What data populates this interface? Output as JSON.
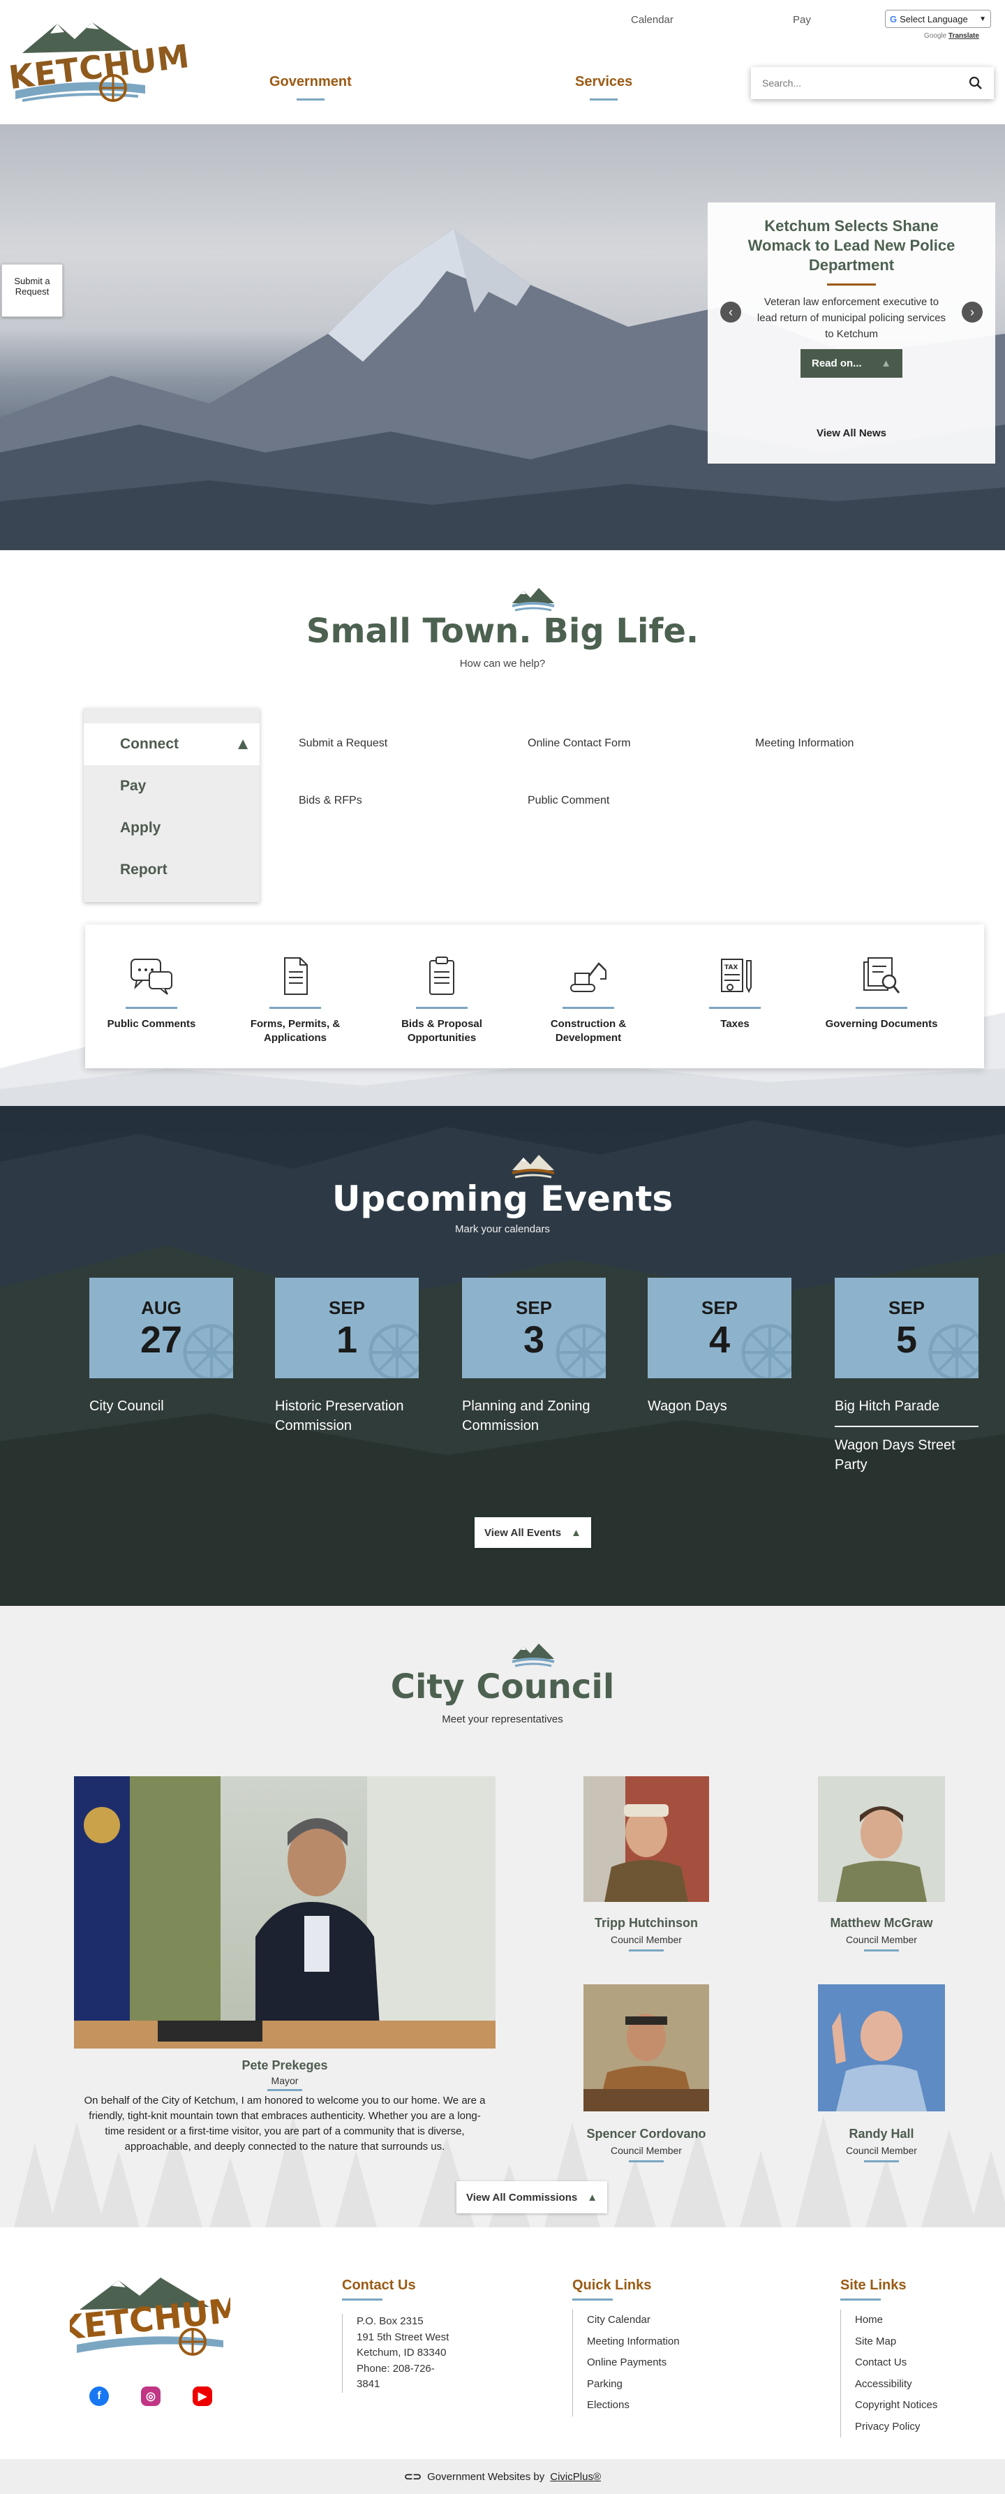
{
  "header": {
    "logo_text": "KETCHUM",
    "top_links": [
      "Calendar",
      "Pay"
    ],
    "language": "Select Language",
    "powered_by": "Google",
    "translate": "Translate",
    "nav": [
      "Government",
      "Services"
    ],
    "search_placeholder": "Search..."
  },
  "hero": {
    "submit_request": "Submit a Request",
    "news_title": "Ketchum Selects Shane Womack to Lead New Police Department",
    "news_body": "Veteran law enforcement executive to lead return of municipal policing services to Ketchum",
    "read_on": "Read on...",
    "view_all_news": "View All News"
  },
  "intro": {
    "tagline": "Small Town. Big Life.",
    "subtitle": "How can we help?"
  },
  "help": {
    "tabs": [
      "Connect",
      "Pay",
      "Apply",
      "Report"
    ],
    "links": [
      "Submit a Request",
      "Online Contact Form",
      "Meeting Information",
      "Bids & RFPs",
      "Public Comment"
    ]
  },
  "categories": [
    {
      "label": "Public Comments",
      "icon": "chat-bubbles-icon"
    },
    {
      "label": "Forms, Permits, & Applications",
      "icon": "document-icon"
    },
    {
      "label": "Bids & Proposal Opportunities",
      "icon": "clipboard-icon"
    },
    {
      "label": "Construction & Development",
      "icon": "excavator-icon"
    },
    {
      "label": "Taxes",
      "icon": "tax-form-icon"
    },
    {
      "label": "Governing Documents",
      "icon": "document-search-icon"
    }
  ],
  "events": {
    "title": "Upcoming Events",
    "subtitle": "Mark your calendars",
    "items": [
      {
        "month": "AUG",
        "day": "27",
        "names": [
          "City Council"
        ]
      },
      {
        "month": "SEP",
        "day": "1",
        "names": [
          "Historic Preservation Commission"
        ]
      },
      {
        "month": "SEP",
        "day": "3",
        "names": [
          "Planning and Zoning Commission"
        ]
      },
      {
        "month": "SEP",
        "day": "4",
        "names": [
          "Wagon Days"
        ]
      },
      {
        "month": "SEP",
        "day": "5",
        "names": [
          "Big Hitch Parade",
          "Wagon Days Street Party"
        ]
      }
    ],
    "view_all": "View All Events"
  },
  "council": {
    "title": "City Council",
    "subtitle": "Meet your representatives",
    "mayor": {
      "name": "Pete Prekeges",
      "role": "Mayor"
    },
    "mayor_message": "On behalf of the City of Ketchum, I am honored to welcome you to our home. We are a friendly, tight-knit mountain town that embraces authenticity. Whether you are a long-time resident or a first-time visitor, you are part of a community that is diverse, approachable, and deeply connected to the nature that surrounds us.",
    "members": [
      {
        "name": "Tripp Hutchinson",
        "role": "Council Member"
      },
      {
        "name": "Matthew McGraw",
        "role": "Council Member"
      },
      {
        "name": "Spencer Cordovano",
        "role": "Council Member"
      },
      {
        "name": "Randy Hall",
        "role": "Council Member"
      }
    ],
    "view_all": "View All Commissions"
  },
  "footer": {
    "contact_title": "Contact Us",
    "contact_lines": [
      "P.O. Box 2315",
      "191 5th Street West",
      "Ketchum, ID 83340",
      "Phone: 208-726-",
      "3841"
    ],
    "quick_title": "Quick Links",
    "quick_links": [
      "City Calendar",
      "Meeting Information",
      "Online Payments",
      "Parking",
      "Elections"
    ],
    "site_title": "Site Links",
    "site_links": [
      "Home",
      "Site Map",
      "Contact Us",
      "Accessibility",
      "Copyright Notices",
      "Privacy Policy"
    ],
    "social": [
      "facebook-icon",
      "instagram-icon",
      "youtube-icon"
    ],
    "credit_prefix": "Government Websites by",
    "credit_brand": "CivicPlus®"
  },
  "colors": {
    "brand_green": "#4d6150",
    "brand_brown": "#9a5a14",
    "accent_blue": "#7aa6c2",
    "event_tile": "#8db3cc"
  }
}
